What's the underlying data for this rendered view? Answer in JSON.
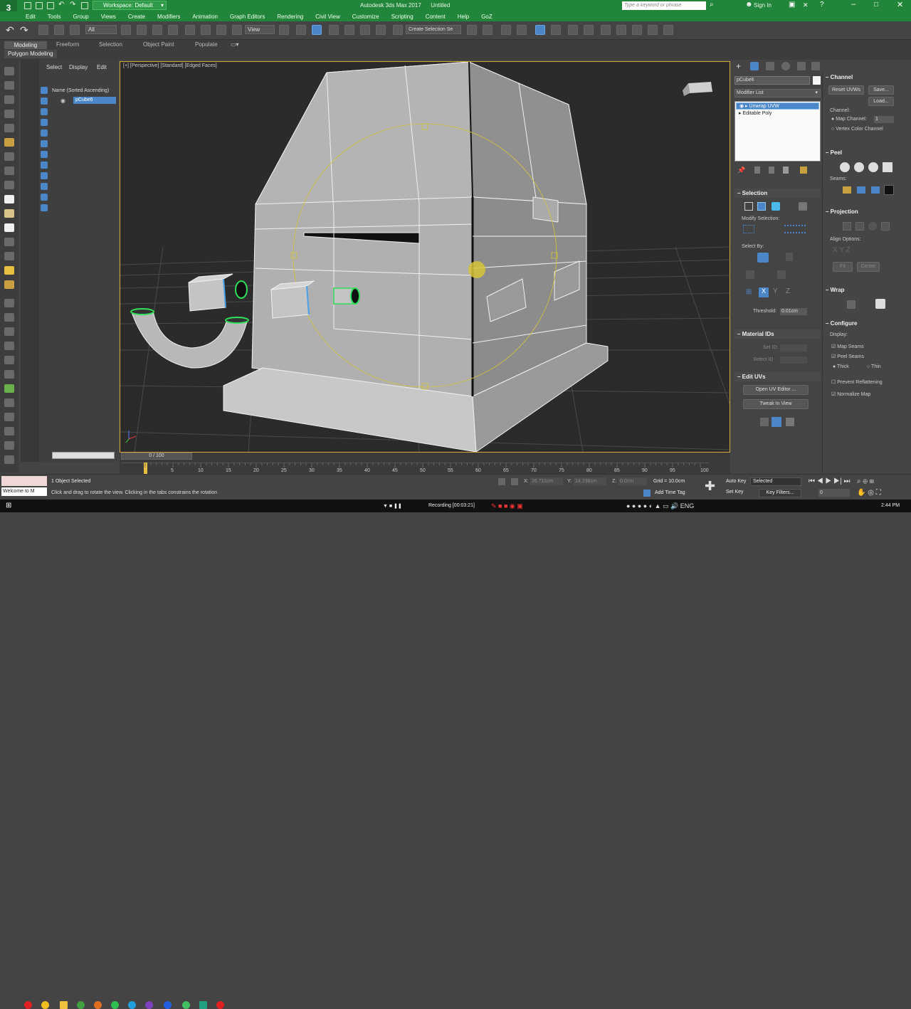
{
  "app": {
    "title": "Autodesk 3ds Max 2017",
    "file": "Untitled",
    "workspace": "Workspace: Default",
    "search_placeholder": "Type a keyword or phrase",
    "sign_in": "Sign In"
  },
  "menu": [
    "Edit",
    "Tools",
    "Group",
    "Views",
    "Create",
    "Modifiers",
    "Animation",
    "Graph Editors",
    "Rendering",
    "Civil View",
    "Customize",
    "Scripting",
    "Content",
    "Help",
    "GoZ"
  ],
  "toolbar": {
    "filter_all": "All",
    "view_dropdown": "View",
    "named_selection": "Create Selection Se"
  },
  "ribbon": {
    "tabs": [
      "Modeling",
      "Freeform",
      "Selection",
      "Object Paint",
      "Populate"
    ],
    "active": "Modeling",
    "sub": "Polygon Modeling"
  },
  "scene_explorer": {
    "menu": [
      "Select",
      "Display",
      "Edit"
    ],
    "header": "Name (Sorted Ascending)",
    "item": "pCube6"
  },
  "viewport": {
    "label": "[+] [Perspective] [Standard] [Edged Faces]"
  },
  "modify_panel": {
    "object_name": "pCube6",
    "modifier_list": "Modifier List",
    "stack": [
      "Unwrap UVW",
      "Editable Poly"
    ],
    "selection_header": "Selection",
    "modify_selection": "Modify Selection:",
    "select_by": "Select By:",
    "threshold_label": "Threshold:",
    "threshold_value": "0.01cm",
    "material_ids_header": "Material IDs",
    "set_id": "Set ID:",
    "select_id": "Select ID",
    "edit_uvs_header": "Edit UVs",
    "open_uv_editor": "Open UV Editor ...",
    "tweak_in_view": "Tweak In View"
  },
  "uv_panel": {
    "channel_header": "Channel",
    "reset_uvws": "Reset UVWs",
    "save": "Save...",
    "load": "Load...",
    "channel_label": "Channel:",
    "map_channel": "Map Channel:",
    "map_channel_value": "1",
    "vertex_color_channel": "Vertex Color Channel",
    "peel_header": "Peel",
    "seams": "Seams:",
    "projection_header": "Projection",
    "align_options": "Align Options:",
    "fit": "Fit",
    "center": "Center",
    "wrap_header": "Wrap",
    "configure_header": "Configure",
    "display_label": "Display:",
    "map_seams": "Map Seams",
    "peel_seams": "Peel Seams",
    "thick": "Thick",
    "thin": "Thin",
    "prevent_reflattening": "Prevent Reflattening",
    "normalize_map": "Normalize Map"
  },
  "timeline": {
    "frame_counter": "0 / 100",
    "ticks": [
      "5",
      "10",
      "15",
      "20",
      "25",
      "30",
      "35",
      "40",
      "45",
      "50",
      "55",
      "60",
      "65",
      "70",
      "75",
      "80",
      "85",
      "90",
      "95",
      "100"
    ],
    "current_frame": "0"
  },
  "status": {
    "selected": "1 Object Selected",
    "prompt": "Click and drag to rotate the view.  Clicking in the tabs constrains the rotation",
    "maxscript": "Welcome to M",
    "x_label": "X:",
    "x_value": "26.711cm",
    "y_label": "Y:",
    "y_value": "14.236cm",
    "z_label": "Z:",
    "z_value": "0.0cm",
    "grid": "Grid = 10.0cm",
    "add_time_tag": "Add Time Tag",
    "auto_key": "Auto Key",
    "set_key": "Set Key",
    "selected_dropdown": "Selected",
    "key_filters": "Key Filters...",
    "frame_value": "0"
  },
  "taskbar": {
    "recording": "Recording [00:03:21]",
    "time": "2:44 PM"
  },
  "colors": {
    "titlebar": "#22863a",
    "viewport_border": "#d7a93c",
    "selection_blue": "#4a86c8",
    "gizmo_yellow": "#d6c43a",
    "highlight_green": "#2fe05a"
  }
}
